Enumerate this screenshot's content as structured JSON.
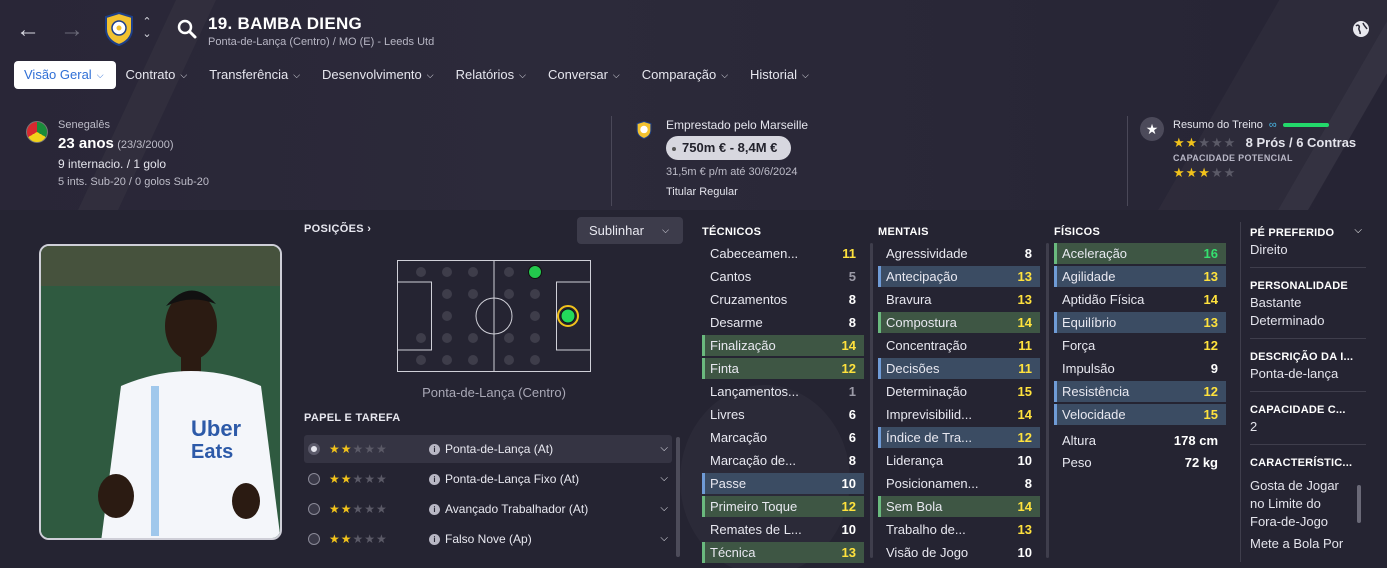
{
  "header": {
    "title": "19. BAMBA DIENG",
    "subtitle": "Ponta-de-Lança (Centro) / MO (E) - Leeds Utd",
    "tabs": [
      {
        "label": "Visão Geral"
      },
      {
        "label": "Contrato"
      },
      {
        "label": "Transferência"
      },
      {
        "label": "Desenvolvimento"
      },
      {
        "label": "Relatórios"
      },
      {
        "label": "Conversar"
      },
      {
        "label": "Comparação"
      },
      {
        "label": "Historial"
      }
    ]
  },
  "personal": {
    "nationality": "Senegalês",
    "age": "23 anos",
    "dob": "(23/3/2000)",
    "caps": "9 internacio. / 1 golo",
    "youth_caps": "5 ints. Sub-20 / 0 golos Sub-20"
  },
  "loan": {
    "status": "Emprestado pelo Marseille",
    "value": "750m € - 8,4M €",
    "wage": "31,5m € p/m até 30/6/2024",
    "squad_status": "Titular Regular"
  },
  "training": {
    "label": "Resumo do Treino",
    "summary": "8 Prós / 6 Contras",
    "potential_label": "CAPACIDADE POTENCIAL",
    "current_stars": 2,
    "potential_stars": 3
  },
  "positions": {
    "heading": "POSIÇÕES",
    "highlight_button": "Sublinhar",
    "caption": "Ponta-de-Lança (Centro)"
  },
  "roles": {
    "heading": "PAPEL E TAREFA",
    "items": [
      {
        "label": "Ponta-de-Lança (At)",
        "stars": 2,
        "selected": true
      },
      {
        "label": "Ponta-de-Lança Fixo (At)",
        "stars": 2,
        "selected": false
      },
      {
        "label": "Avançado Trabalhador (At)",
        "stars": 2,
        "selected": false
      },
      {
        "label": "Falso Nove (Ap)",
        "stars": 2,
        "selected": false
      }
    ]
  },
  "technical": {
    "heading": "TÉCNICOS",
    "items": [
      {
        "name": "Cabeceamen...",
        "value": "11",
        "hl": "",
        "color": "yellow"
      },
      {
        "name": "Cantos",
        "value": "5",
        "hl": "",
        "color": "grey"
      },
      {
        "name": "Cruzamentos",
        "value": "8",
        "hl": "",
        "color": "white"
      },
      {
        "name": "Desarme",
        "value": "8",
        "hl": "",
        "color": "white"
      },
      {
        "name": "Finalização",
        "value": "14",
        "hl": "green",
        "color": "yellow"
      },
      {
        "name": "Finta",
        "value": "12",
        "hl": "green",
        "color": "yellow"
      },
      {
        "name": "Lançamentos...",
        "value": "1",
        "hl": "",
        "color": "grey"
      },
      {
        "name": "Livres",
        "value": "6",
        "hl": "",
        "color": "white"
      },
      {
        "name": "Marcação",
        "value": "6",
        "hl": "",
        "color": "white"
      },
      {
        "name": "Marcação de...",
        "value": "8",
        "hl": "",
        "color": "white"
      },
      {
        "name": "Passe",
        "value": "10",
        "hl": "blue",
        "color": "white"
      },
      {
        "name": "Primeiro Toque",
        "value": "12",
        "hl": "green",
        "color": "yellow"
      },
      {
        "name": "Remates de L...",
        "value": "10",
        "hl": "",
        "color": "white"
      },
      {
        "name": "Técnica",
        "value": "13",
        "hl": "green",
        "color": "yellow"
      }
    ]
  },
  "mental": {
    "heading": "MENTAIS",
    "items": [
      {
        "name": "Agressividade",
        "value": "8",
        "hl": "",
        "color": "white"
      },
      {
        "name": "Antecipação",
        "value": "13",
        "hl": "blue",
        "color": "yellow"
      },
      {
        "name": "Bravura",
        "value": "13",
        "hl": "",
        "color": "yellow"
      },
      {
        "name": "Compostura",
        "value": "14",
        "hl": "green",
        "color": "yellow"
      },
      {
        "name": "Concentração",
        "value": "11",
        "hl": "",
        "color": "yellow"
      },
      {
        "name": "Decisões",
        "value": "11",
        "hl": "blue",
        "color": "yellow"
      },
      {
        "name": "Determinação",
        "value": "15",
        "hl": "",
        "color": "yellow"
      },
      {
        "name": "Imprevisibilid...",
        "value": "14",
        "hl": "",
        "color": "yellow"
      },
      {
        "name": "Índice de Tra...",
        "value": "12",
        "hl": "blue",
        "color": "yellow"
      },
      {
        "name": "Liderança",
        "value": "10",
        "hl": "",
        "color": "white"
      },
      {
        "name": "Posicionamen...",
        "value": "8",
        "hl": "",
        "color": "white"
      },
      {
        "name": "Sem Bola",
        "value": "14",
        "hl": "green",
        "color": "yellow"
      },
      {
        "name": "Trabalho de...",
        "value": "13",
        "hl": "",
        "color": "yellow"
      },
      {
        "name": "Visão de Jogo",
        "value": "10",
        "hl": "",
        "color": "white"
      }
    ]
  },
  "physical": {
    "heading": "FÍSICOS",
    "items": [
      {
        "name": "Aceleração",
        "value": "16",
        "hl": "green",
        "color": "green"
      },
      {
        "name": "Agilidade",
        "value": "13",
        "hl": "blue",
        "color": "yellow"
      },
      {
        "name": "Aptidão Física",
        "value": "14",
        "hl": "",
        "color": "yellow"
      },
      {
        "name": "Equilíbrio",
        "value": "13",
        "hl": "blue",
        "color": "yellow"
      },
      {
        "name": "Força",
        "value": "12",
        "hl": "",
        "color": "yellow"
      },
      {
        "name": "Impulsão",
        "value": "9",
        "hl": "",
        "color": "white"
      },
      {
        "name": "Resistência",
        "value": "12",
        "hl": "blue",
        "color": "yellow"
      },
      {
        "name": "Velocidade",
        "value": "15",
        "hl": "blue",
        "color": "yellow"
      }
    ],
    "height_label": "Altura",
    "height": "178 cm",
    "weight_label": "Peso",
    "weight": "72 kg"
  },
  "side": {
    "foot_label": "PÉ PREFERIDO",
    "foot": "Direito",
    "personality_label": "PERSONALIDADE",
    "personality": "Bastante Determinado",
    "description_label": "DESCRIÇÃO DA I...",
    "description": "Ponta-de-lança",
    "ability_label": "CAPACIDADE C...",
    "ability": "2",
    "traits_label": "CARACTERÍSTIC...",
    "traits": "Gosta de Jogar no Limite do Fora-de-Jogo",
    "traits2": "Mete a Bola Por"
  },
  "colors": {
    "accent": "#2f6fd6",
    "highlight_green": "#3e5644",
    "highlight_blue": "#3b4c63",
    "value_yellow": "#ffe23d",
    "value_green": "#35e06f"
  }
}
